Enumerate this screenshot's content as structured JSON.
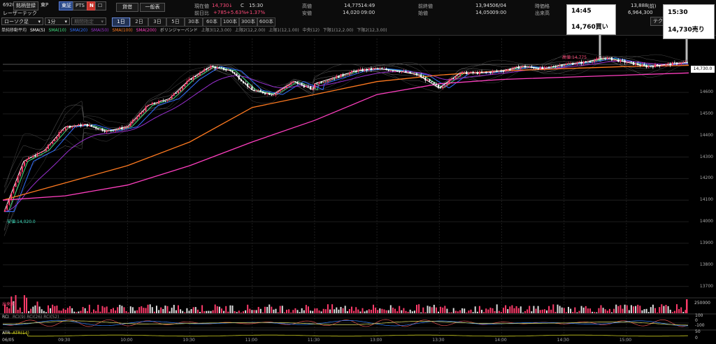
{
  "header": {
    "code": "6920",
    "company": "レーザーテック",
    "market_buttons": [
      "銘柄登録",
      "東P"
    ],
    "venue_buttons": [
      "東証",
      "PTS"
    ],
    "n_badge": "N",
    "action_buttons": [
      "貸借",
      "一般表"
    ],
    "current_label": "現在値",
    "current_value": "14,730",
    "current_arrow": "↓",
    "current_flag": "C",
    "current_time": "15:30",
    "prev_change_label": "前日比",
    "prev_change": "+785",
    "prev_change_pct": "+5.63%",
    "prev_change_pct2": "+1.37%",
    "high_label": "高値",
    "high_value": "14,775",
    "high_time": "14:49",
    "low_label": "安値",
    "low_value": "14,020",
    "low_time": "09:00",
    "prev_close_label": "前終値",
    "prev_close_value": "13,945",
    "prev_close_date": "06/04",
    "open_label": "始値",
    "open_value": "14,050",
    "open_time": "09:00",
    "after_label": "時価格",
    "after_value": "13,888",
    "after_unit": "(前)",
    "volume_label": "出来高",
    "volume_value": "6,964,300",
    "tech_label": "テクニ"
  },
  "controls": {
    "chart_type": "ローソク足",
    "interval": "1分",
    "range_placeholder": "期間指定",
    "timeframes": [
      "1日",
      "2日",
      "3日",
      "5日",
      "30本",
      "60本",
      "100本",
      "300本",
      "600本"
    ],
    "active_timeframe": "1日"
  },
  "legend": {
    "title": "単純移動平均",
    "sma5": "SMA(5)",
    "sma10": "SMA(10)",
    "sma20": "SMA(20)",
    "sma50": "SMA(50)",
    "sma100": "SMA(100)",
    "sma200": "SMA(200)",
    "bb_title": "ボリンジャーバンド",
    "bb3u": "上限3(12,3.00)",
    "bb2u": "上限2(12,2.00)",
    "bb1u": "上限1(12,1.00)",
    "bb_mid": "中央(12)",
    "bb1l": "下限1(12,2.00)",
    "bb2l": "下限2(12,3.00)",
    "bb3l": "下限3(12,3.00)"
  },
  "colors": {
    "up": "#ff3b6a",
    "down": "#ffffff",
    "sma5": "#ffffff",
    "sma10": "#40e080",
    "sma20": "#3070ff",
    "sma50": "#9a30d0",
    "sma100": "#ff7a20",
    "sma200": "#ff3fc0",
    "bb": "#7a7a7a",
    "accent": "#2a4a8a"
  },
  "annotations": {
    "high_tag": "高値:14,775",
    "low_tag": "安値:14,020.0",
    "last_price": "14,730.0"
  },
  "callouts": [
    {
      "time": "14:45",
      "price": "14,760買い"
    },
    {
      "time": "15:30",
      "price": "14,730売り"
    }
  ],
  "subpanels": {
    "volume_label": "出来高",
    "volume_max": "250000",
    "rci_label": "RCI",
    "rci_params": "RCI(9) RCI(26) RCI(52)",
    "rci_ticks": [
      "100",
      "0",
      "-100"
    ],
    "atr_label": "ATR",
    "atr_params": "ATR(14)",
    "atr_ticks": [
      "50",
      "0"
    ]
  },
  "chart_data": {
    "type": "line",
    "ylim": [
      13650,
      14850
    ],
    "y_ticks": [
      14700,
      14600,
      14500,
      14400,
      14300,
      14200,
      14100,
      14000,
      13900,
      13800,
      13700
    ],
    "x_ticks": [
      "09:30",
      "10:00",
      "10:30",
      "11:00",
      "11:30",
      "13:00",
      "13:30",
      "14:00",
      "14:30",
      "15:00"
    ],
    "date_label": "06/05",
    "series": [
      {
        "name": "SMA(5)",
        "x": [
          "09:00",
          "09:10",
          "09:20",
          "09:30",
          "09:40",
          "09:50",
          "10:00",
          "10:10",
          "10:20",
          "10:30",
          "10:40",
          "10:50",
          "11:00",
          "11:10",
          "11:20",
          "11:30",
          "12:30",
          "12:40",
          "12:50",
          "13:00",
          "13:10",
          "13:20",
          "13:30",
          "13:40",
          "13:50",
          "14:00",
          "14:10",
          "14:20",
          "14:30",
          "14:40",
          "14:50",
          "15:00",
          "15:10",
          "15:20",
          "15:30"
        ],
        "values": [
          14030,
          14280,
          14330,
          14440,
          14450,
          14420,
          14440,
          14540,
          14570,
          14660,
          14720,
          14700,
          14610,
          14590,
          14650,
          14610,
          14640,
          14670,
          14700,
          14710,
          14700,
          14680,
          14620,
          14690,
          14690,
          14700,
          14720,
          14710,
          14730,
          14740,
          14760,
          14740,
          14720,
          14730,
          14740
        ]
      },
      {
        "name": "SMA(100)",
        "x": [
          "09:00",
          "09:30",
          "10:00",
          "10:30",
          "11:00",
          "11:30",
          "13:00",
          "13:30",
          "14:00",
          "14:30",
          "15:00",
          "15:30"
        ],
        "values": [
          14100,
          14180,
          14260,
          14370,
          14530,
          14590,
          14650,
          14680,
          14700,
          14710,
          14720,
          14725
        ]
      },
      {
        "name": "SMA(200)",
        "x": [
          "09:00",
          "09:30",
          "10:00",
          "10:30",
          "11:00",
          "11:30",
          "13:00",
          "13:30",
          "14:00",
          "14:30",
          "15:00",
          "15:30"
        ],
        "values": [
          14100,
          14120,
          14170,
          14260,
          14370,
          14470,
          14590,
          14640,
          14660,
          14670,
          14680,
          14690
        ]
      }
    ]
  }
}
